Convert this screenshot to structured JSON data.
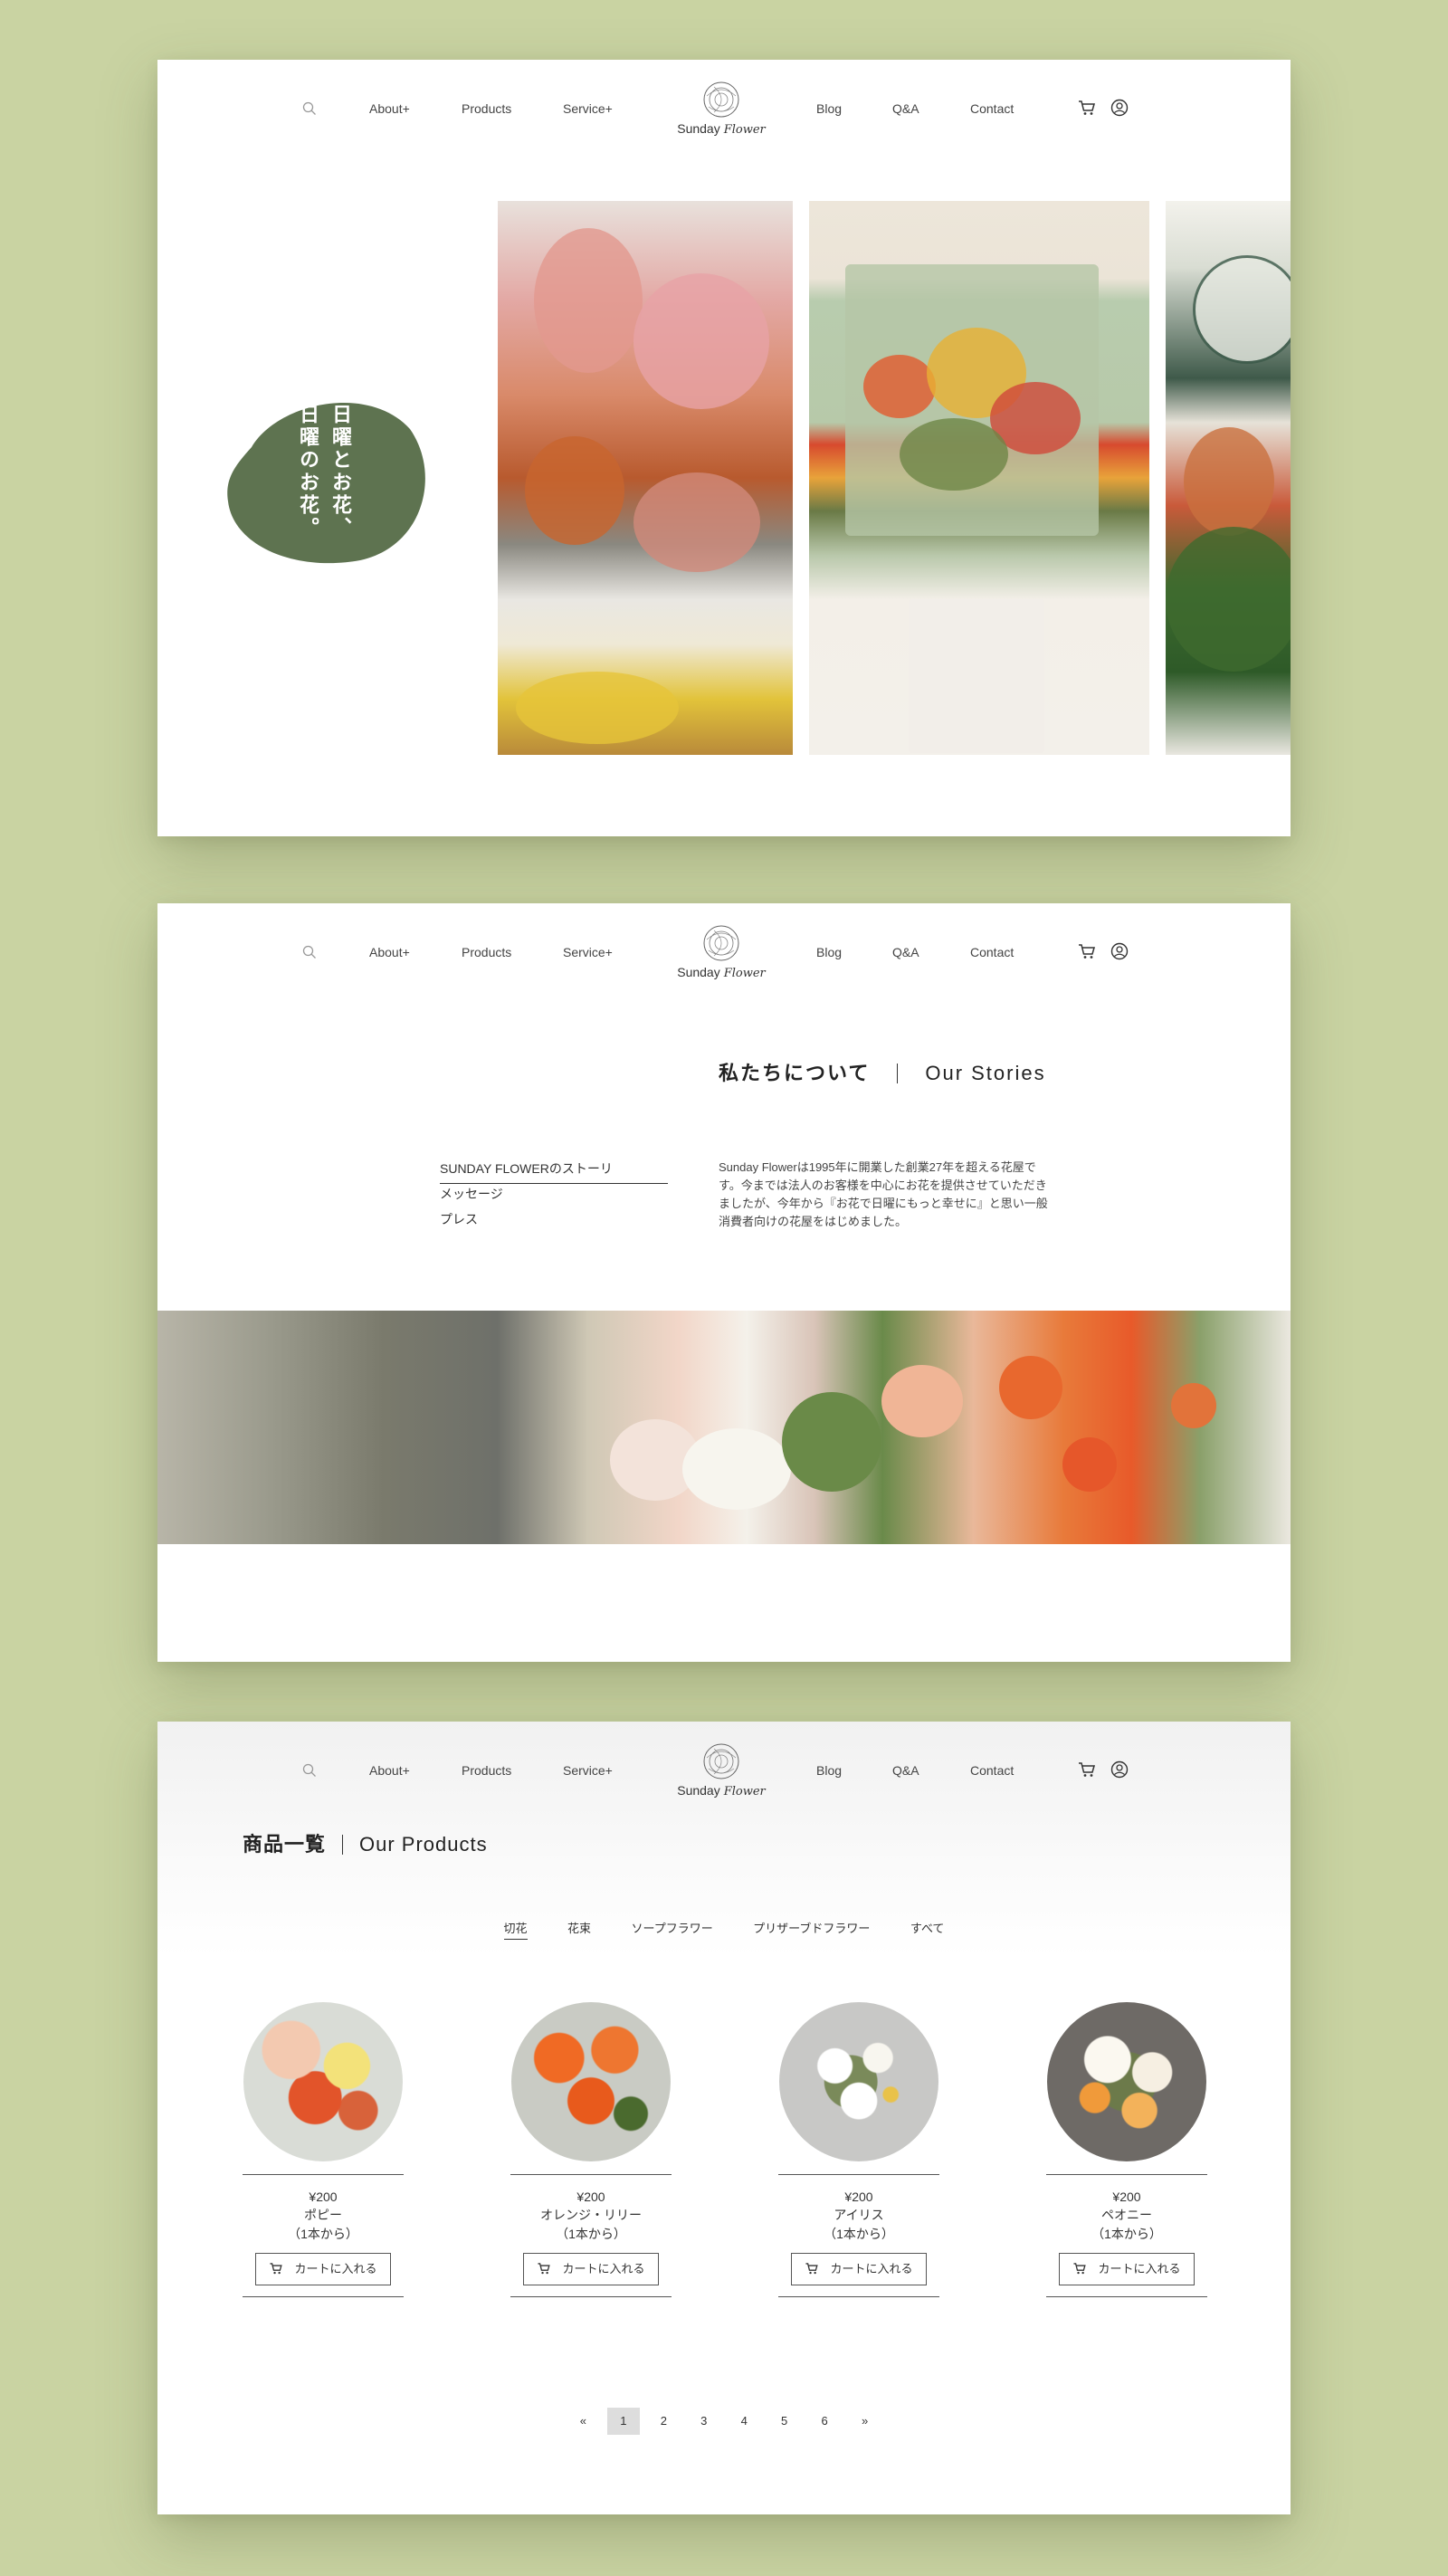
{
  "nav": {
    "items_left": [
      "About+",
      "Products",
      "Service+"
    ],
    "items_right": [
      "Blog",
      "Q&A",
      "Contact"
    ],
    "logo_word": "Sunday",
    "logo_script": "Flower"
  },
  "hero": {
    "tagline": "日曜とお花、日曜のお花。",
    "blob_color": "#5e7350"
  },
  "about": {
    "title_ja": "私たちについて",
    "title_en": "Our Stories",
    "menu": [
      "SUNDAY FLOWERのストーリ",
      "メッセージ",
      "プレス"
    ],
    "body": "Sunday Flowerは1995年に開業した創業27年を超える花屋です。今までは法人のお客様を中心にお花を提供させていただきましたが、今年から『お花で日曜にもっと幸せに』と思い一般消費者向けの花屋をはじめました。"
  },
  "products": {
    "title_ja": "商品一覧",
    "title_en": "Our Products",
    "tabs": [
      "切花",
      "花束",
      "ソープフラワー",
      "プリザーブドフラワー",
      "すべて"
    ],
    "items": [
      {
        "price": "¥200",
        "name": "ポピー",
        "unit": "（1本から）",
        "button": "カートに入れる"
      },
      {
        "price": "¥200",
        "name": "オレンジ・リリー",
        "unit": "（1本から）",
        "button": "カートに入れる"
      },
      {
        "price": "¥200",
        "name": "アイリス",
        "unit": "（1本から）",
        "button": "カートに入れる"
      },
      {
        "price": "¥200",
        "name": "ペオニー",
        "unit": "（1本から）",
        "button": "カートに入れる"
      }
    ],
    "pagination": [
      "«",
      "1",
      "2",
      "3",
      "4",
      "5",
      "6",
      "»"
    ]
  },
  "colors": {
    "background": "#c9d3a2",
    "accent_green": "#5e7350"
  },
  "icons": [
    "search-icon",
    "cart-icon",
    "user-icon",
    "logo-flower-icon"
  ]
}
